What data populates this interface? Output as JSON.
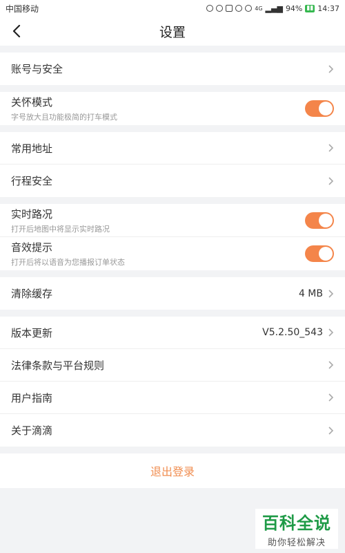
{
  "status_bar": {
    "carrier": "中国移动",
    "battery": "94%",
    "time": "14:37",
    "signal_label": "4G"
  },
  "nav": {
    "title": "设置"
  },
  "groups": {
    "account": {
      "label": "账号与安全"
    },
    "care_mode": {
      "label": "关怀模式",
      "sub": "字号放大且功能极简的打车模式",
      "on": true
    },
    "addresses": {
      "label": "常用地址"
    },
    "trip_safety": {
      "label": "行程安全"
    },
    "traffic": {
      "label": "实时路况",
      "sub": "打开后地图中将显示实时路况",
      "on": true
    },
    "sound": {
      "label": "音效提示",
      "sub": "打开后将以语音为您播报订单状态",
      "on": true
    },
    "cache": {
      "label": "清除缓存",
      "value": "4 MB"
    },
    "version": {
      "label": "版本更新",
      "value": "V5.2.50_543"
    },
    "legal": {
      "label": "法律条款与平台规则"
    },
    "guide": {
      "label": "用户指南"
    },
    "about": {
      "label": "关于滴滴"
    }
  },
  "logout": {
    "label": "退出登录"
  },
  "watermark": {
    "main": "百科全说",
    "sub": "助你轻松解决"
  },
  "colors": {
    "accent": "#f4854a",
    "logout": "#f08d50",
    "watermark": "#1e9a46"
  }
}
